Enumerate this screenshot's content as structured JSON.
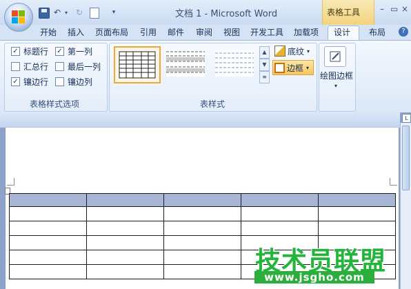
{
  "window": {
    "title": "文档 1 - Microsoft Word",
    "context_tools": "表格工具",
    "controls": {
      "minimize": "–",
      "maximize": "▭",
      "close": "×"
    }
  },
  "quick_access": {
    "undo": "↶",
    "undo_dropdown": "▾",
    "redo": "↻",
    "more": "▾"
  },
  "tabs": [
    "开始",
    "插入",
    "页面布局",
    "引用",
    "邮件",
    "审阅",
    "视图",
    "开发工具",
    "加载项",
    "设计",
    "布局"
  ],
  "active_tab": "设计",
  "help": "?",
  "groups": {
    "options": {
      "label": "表格样式选项",
      "checkboxes": [
        {
          "label": "标题行",
          "checked": true
        },
        {
          "label": "第一列",
          "checked": true
        },
        {
          "label": "汇总行",
          "checked": false
        },
        {
          "label": "最后一列",
          "checked": false
        },
        {
          "label": "镶边行",
          "checked": true
        },
        {
          "label": "镶边列",
          "checked": false
        }
      ]
    },
    "styles": {
      "label": "表样式",
      "shading_label": "底纹",
      "borders_label": "边框",
      "scroll_up": "▲",
      "scroll_down": "▼",
      "scroll_more": "≡"
    },
    "draw": {
      "label": "绘图边框",
      "caret": "▾"
    }
  },
  "ruler_tab": "L",
  "table": {
    "rows": 6,
    "cols": 5
  },
  "watermark": {
    "text": "技术员联盟",
    "url": "www.jsgho.com"
  },
  "colors": {
    "header_fill": "#a9b5d4",
    "accent": "#f7c65b",
    "watermark": "#23b43a"
  }
}
